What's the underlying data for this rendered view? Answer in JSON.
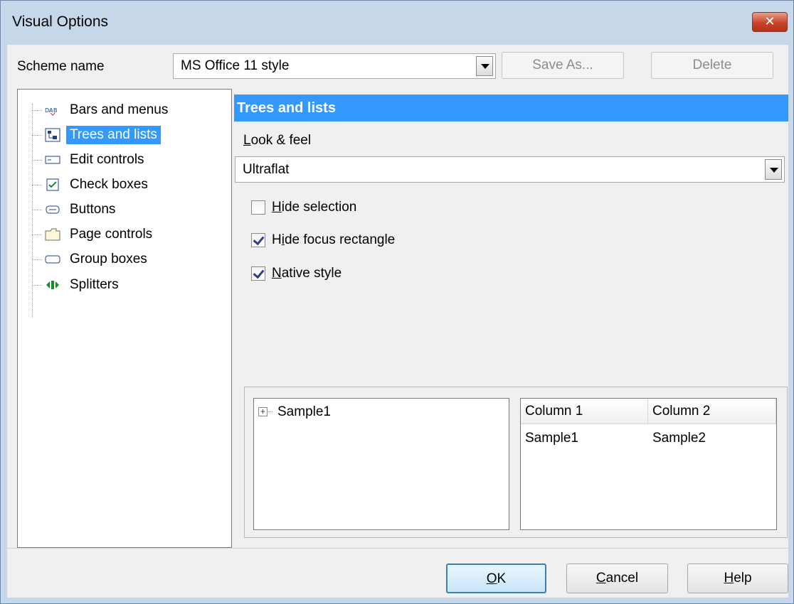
{
  "window": {
    "title": "Visual Options",
    "close_label": "✕"
  },
  "scheme": {
    "label": "Scheme name",
    "selected": "MS Office 11 style",
    "save_as_label": "Save As...",
    "delete_label": "Delete"
  },
  "tree": {
    "items": [
      {
        "label": "Bars and menus",
        "icon": "bars-menus-icon"
      },
      {
        "label": "Trees and lists",
        "icon": "trees-lists-icon",
        "selected": true
      },
      {
        "label": "Edit controls",
        "icon": "edit-controls-icon"
      },
      {
        "label": "Check boxes",
        "icon": "check-boxes-icon"
      },
      {
        "label": "Buttons",
        "icon": "buttons-icon"
      },
      {
        "label": "Page controls",
        "icon": "page-controls-icon"
      },
      {
        "label": "Group boxes",
        "icon": "group-boxes-icon"
      },
      {
        "label": "Splitters",
        "icon": "splitters-icon"
      }
    ]
  },
  "section": {
    "title": "Trees and lists",
    "look_feel_label_first": "L",
    "look_feel_label_rest": "ook & feel",
    "look_feel_value": "Ultraflat",
    "hide_selection": {
      "u": "H",
      "rest": "ide selection",
      "checked": false
    },
    "hide_focus": {
      "u": "i",
      "pre": "H",
      "rest": "de focus rectangle",
      "checked": true
    },
    "native_style": {
      "u": "N",
      "rest": "ative style",
      "checked": true
    }
  },
  "preview": {
    "tree_node": "Sample1",
    "columns": [
      "Column 1",
      "Column 2"
    ],
    "row": [
      "Sample1",
      "Sample2"
    ]
  },
  "footer": {
    "ok_u": "O",
    "ok_rest": "K",
    "cancel_u": "C",
    "cancel_rest": "ancel",
    "help_u": "H",
    "help_rest": "elp"
  },
  "colors": {
    "accent": "#3399ff",
    "titlebar": "#c7d7ea",
    "close_button": "#c9432a"
  }
}
